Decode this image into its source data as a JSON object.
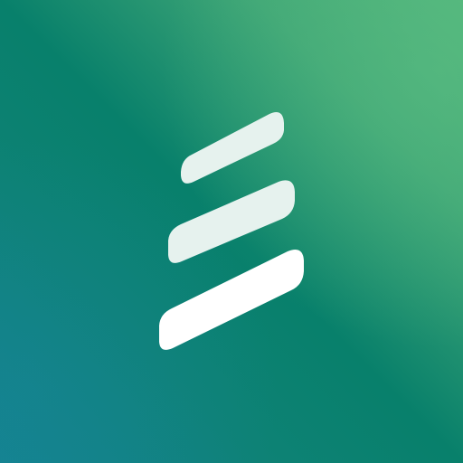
{
  "icon": {
    "name": "stacked-bars-logo-icon",
    "colors": {
      "gradient_top_right": "#52B57C",
      "gradient_middle": "#08806B",
      "gradient_bottom_left": "#14838F",
      "bar_top": "#E6F2EE",
      "bar_middle": "#E6F2EE",
      "bar_bottom": "#FFFFFF"
    }
  }
}
